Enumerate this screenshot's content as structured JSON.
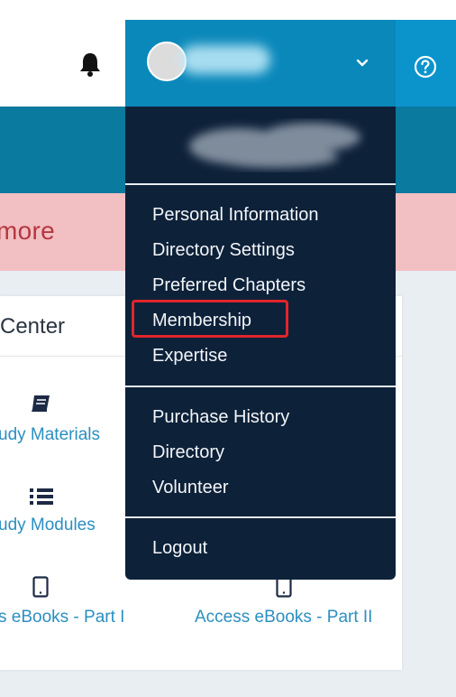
{
  "header": {
    "notifications_icon": "bell-icon",
    "help_icon": "question-circle-icon",
    "menu_toggle_icon": "chevron-down-icon"
  },
  "alert": {
    "text": "more"
  },
  "card": {
    "title": "Center",
    "tiles": [
      {
        "label": "udy Materials",
        "icon": "book-icon"
      },
      {
        "label": "udy Modules",
        "icon": "list-icon"
      },
      {
        "label": "s eBooks - Part I",
        "icon": "tablet-icon"
      },
      {
        "label": "Access eBooks - Part II",
        "icon": "tablet-icon"
      }
    ]
  },
  "user_menu": {
    "groups": [
      [
        {
          "label": "Personal Information"
        },
        {
          "label": "Directory Settings"
        },
        {
          "label": "Preferred Chapters"
        },
        {
          "label": "Membership"
        },
        {
          "label": "Expertise"
        }
      ],
      [
        {
          "label": "Purchase History"
        },
        {
          "label": "Directory"
        },
        {
          "label": "Volunteer"
        }
      ],
      [
        {
          "label": "Logout"
        }
      ]
    ],
    "highlighted_item": "Membership",
    "highlight_color": "#e0262b"
  },
  "colors": {
    "banner": "#0a7a9f",
    "alert_bg": "#f2bfc3",
    "alert_text": "#b5373f",
    "menu_bg": "#0d2139",
    "link": "#2b8fc0",
    "accent": "#0b93cc"
  }
}
